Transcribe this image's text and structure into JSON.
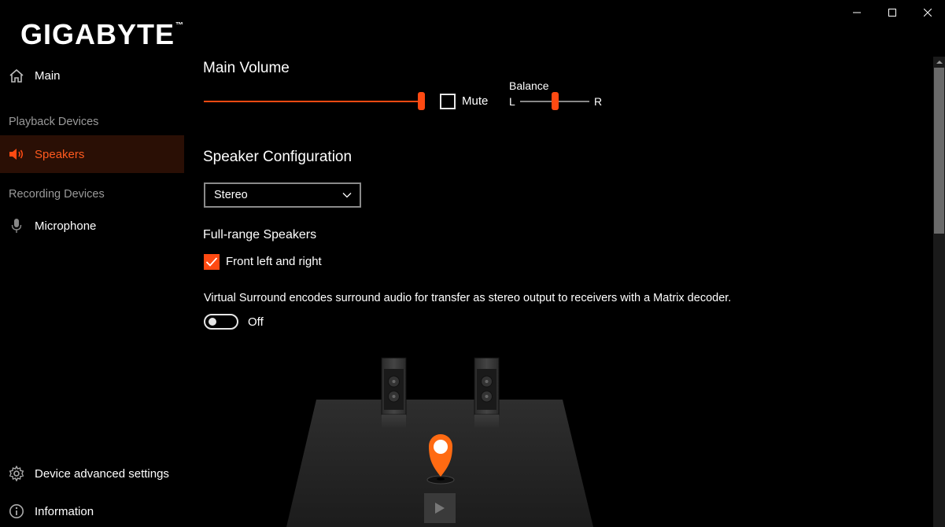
{
  "brand": {
    "name": "GIGABYTE",
    "tm": "™"
  },
  "window": {
    "controls": [
      "minimize",
      "maximize",
      "close"
    ]
  },
  "sidebar": {
    "main": {
      "label": "Main",
      "icon": "home-icon"
    },
    "playback_section": "Playback Devices",
    "speakers": {
      "label": "Speakers",
      "icon": "speaker-icon",
      "active": true
    },
    "recording_section": "Recording Devices",
    "microphone": {
      "label": "Microphone",
      "icon": "microphone-icon"
    },
    "advanced": {
      "label": "Device advanced settings",
      "icon": "gear-icon"
    },
    "information": {
      "label": "Information",
      "icon": "info-icon"
    }
  },
  "main_volume": {
    "title": "Main Volume",
    "level": 1.0,
    "mute_label": "Mute",
    "muted": false,
    "balance": {
      "title": "Balance",
      "left": "L",
      "right": "R",
      "position": 0.5
    }
  },
  "speaker_config": {
    "title": "Speaker Configuration",
    "selected": "Stereo"
  },
  "full_range": {
    "title": "Full-range Speakers",
    "front_label": "Front left and right",
    "front_checked": true
  },
  "virtual_surround": {
    "description": "Virtual Surround encodes surround audio for transfer as stereo output to receivers with a Matrix decoder.",
    "state_label": "Off",
    "enabled": false
  },
  "colors": {
    "accent": "#ff4a12",
    "background": "#000000",
    "active_nav_bg": "#2a0f05",
    "section_label": "#9a9a9a"
  }
}
